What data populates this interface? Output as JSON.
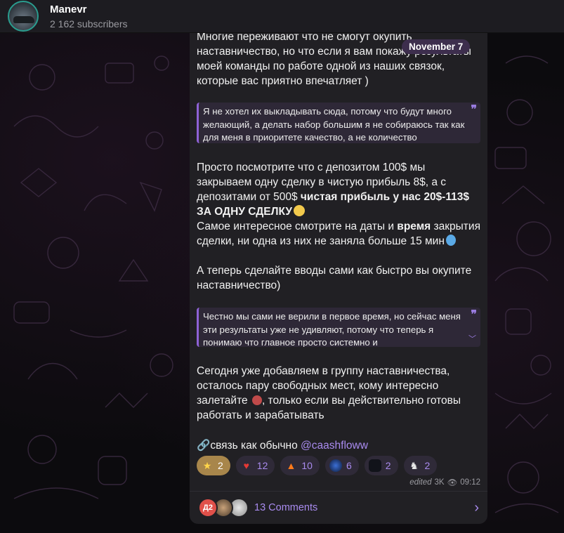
{
  "header": {
    "channel_name": "Manevr",
    "subscribers": "2 162 subscribers"
  },
  "date_pill": "November 7",
  "message": {
    "p1": "Многие переживают что не смогут окупить наставничество, но что если я вам покажу результаты моей команды по работе одной из наших связок, которые вас приятно впечатляет )",
    "quote1": "Я не хотел их выкладывать сюда, потому что будут много желающий, а делать набор большим я не собираюсь так как для меня в приоритете качество, а не количество",
    "p2_a": "Просто посмотрите  что с депозитом 100$ мы закрываем одну сделку в чистую прибыль 8$, а с депозитами от 500$ ",
    "p2_b": "чистая прибыль у нас  20$-113$ ЗА ОДНУ СДЕЛКУ",
    "p3_a": "Самое интересное смотрите на даты и ",
    "p3_b": "время",
    "p3_c": " закрытия сделки, ни одна из них не заняла больше 15 мин",
    "p4": "А теперь сделайте вводы сами как быстро вы окупите наставничество)",
    "quote2": "Честно мы сами не верили в первое время, но сейчас меня эти результаты уже не удивляют, потому что теперь я понимаю что главное просто системно и",
    "p5_a": "Сегодня уже добавляем в группу наставничества, осталось пару свободных мест, кому интересно залетайте ",
    "p5_b": ", только если вы действительно готовы работать и зарабатывать",
    "p6_text": "связь как обычно ",
    "p6_mention": "@caashfloww"
  },
  "reactions": [
    {
      "icon": "star-emoji",
      "count": "2",
      "active": true
    },
    {
      "icon": "heart-emoji",
      "count": "12"
    },
    {
      "icon": "fire-emoji",
      "count": "10"
    },
    {
      "icon": "custom-emoji-planet",
      "count": "6"
    },
    {
      "icon": "custom-emoji-car",
      "count": "2"
    },
    {
      "icon": "custom-emoji-figure",
      "count": "2"
    }
  ],
  "meta": {
    "edited": "edited",
    "views": "3K",
    "time": "09:12"
  },
  "comments": {
    "avatar_initials": "Д2",
    "label": "13 Comments"
  },
  "colors": {
    "accent": "#a98bef",
    "bubble": "#212024",
    "quote_bg": "#2e2837",
    "quote_border": "#8e62d6",
    "header": "#1d1c21"
  }
}
